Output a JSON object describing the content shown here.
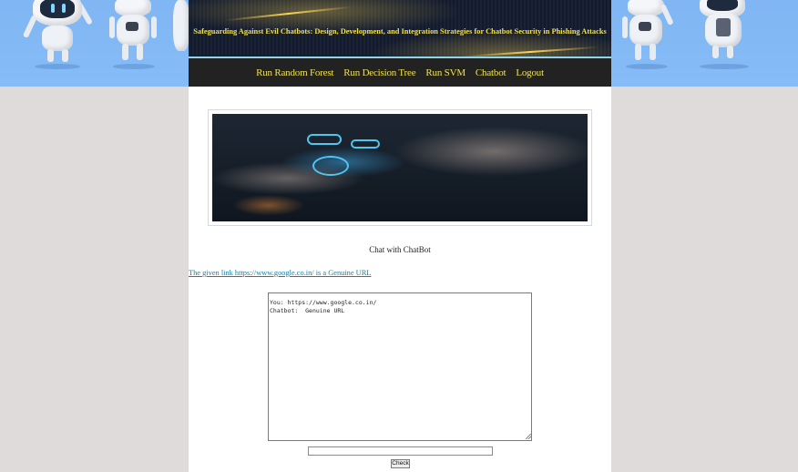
{
  "header": {
    "title": "Safeguarding Against Evil Chatbots: Design, Development, and Integration Strategies for Chatbot Security in Phishing Attacks"
  },
  "nav": {
    "items": [
      {
        "label": "Run Random Forest"
      },
      {
        "label": "Run Decision Tree"
      },
      {
        "label": "Run SVM"
      },
      {
        "label": "Chatbot"
      },
      {
        "label": "Logout"
      }
    ]
  },
  "main": {
    "chat_heading": "Chat with ChatBot",
    "result_text": "The given link https://www.google.co.in/ is a Genuine URL",
    "chat_log": "You: https://www.google.co.in/\nChatbot:  Genuine URL",
    "input_value": "",
    "check_label": "Check"
  },
  "colors": {
    "accent_yellow": "#f2e14a",
    "nav_bg": "#222222",
    "sky_blue": "#7fb6f3",
    "link": "#1a7fa0"
  }
}
